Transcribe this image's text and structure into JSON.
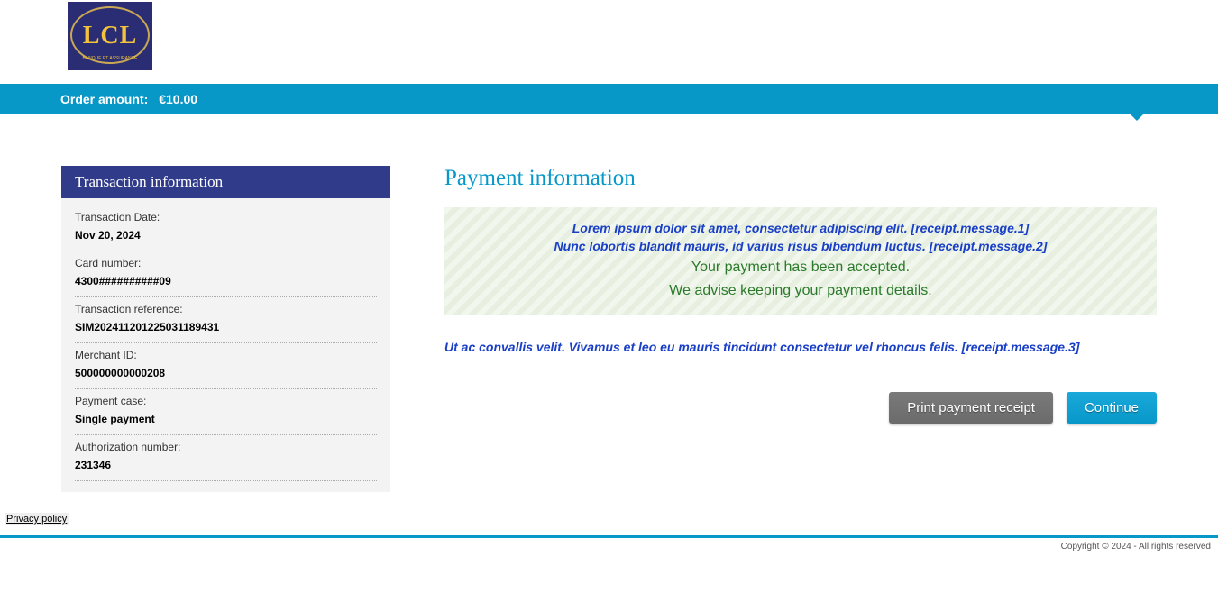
{
  "logo": {
    "main_text": "LCL",
    "sub_text": "BANQUE ET ASSURANCE"
  },
  "order_bar": {
    "label": "Order amount:",
    "amount": "€10.00"
  },
  "sidebar": {
    "title": "Transaction information",
    "items": [
      {
        "label": "Transaction Date:",
        "value": "Nov 20, 2024"
      },
      {
        "label": "Card number:",
        "value": "4300##########09"
      },
      {
        "label": "Transaction reference:",
        "value": "SIM202411201225031189431"
      },
      {
        "label": "Merchant ID:",
        "value": "500000000000208"
      },
      {
        "label": "Payment case:",
        "value": "Single payment"
      },
      {
        "label": "Authorization number:",
        "value": "231346"
      }
    ]
  },
  "content": {
    "title": "Payment information",
    "message_box": {
      "blue_line1": "Lorem ipsum dolor sit amet, consectetur adipiscing elit. [receipt.message.1]",
      "blue_line2": "Nunc lobortis blandit mauris, id varius risus bibendum luctus. [receipt.message.2]",
      "green_line1": "Your payment has been accepted.",
      "green_line2": "We advise keeping your payment details."
    },
    "extra_message": "Ut ac convallis velit. Vivamus et leo eu mauris tincidunt consectetur vel rhoncus felis. [receipt.message.3]",
    "buttons": {
      "print": "Print payment receipt",
      "continue": "Continue"
    }
  },
  "footer": {
    "privacy_link": "Privacy policy",
    "copyright": "Copyright © 2024 - All rights reserved"
  }
}
